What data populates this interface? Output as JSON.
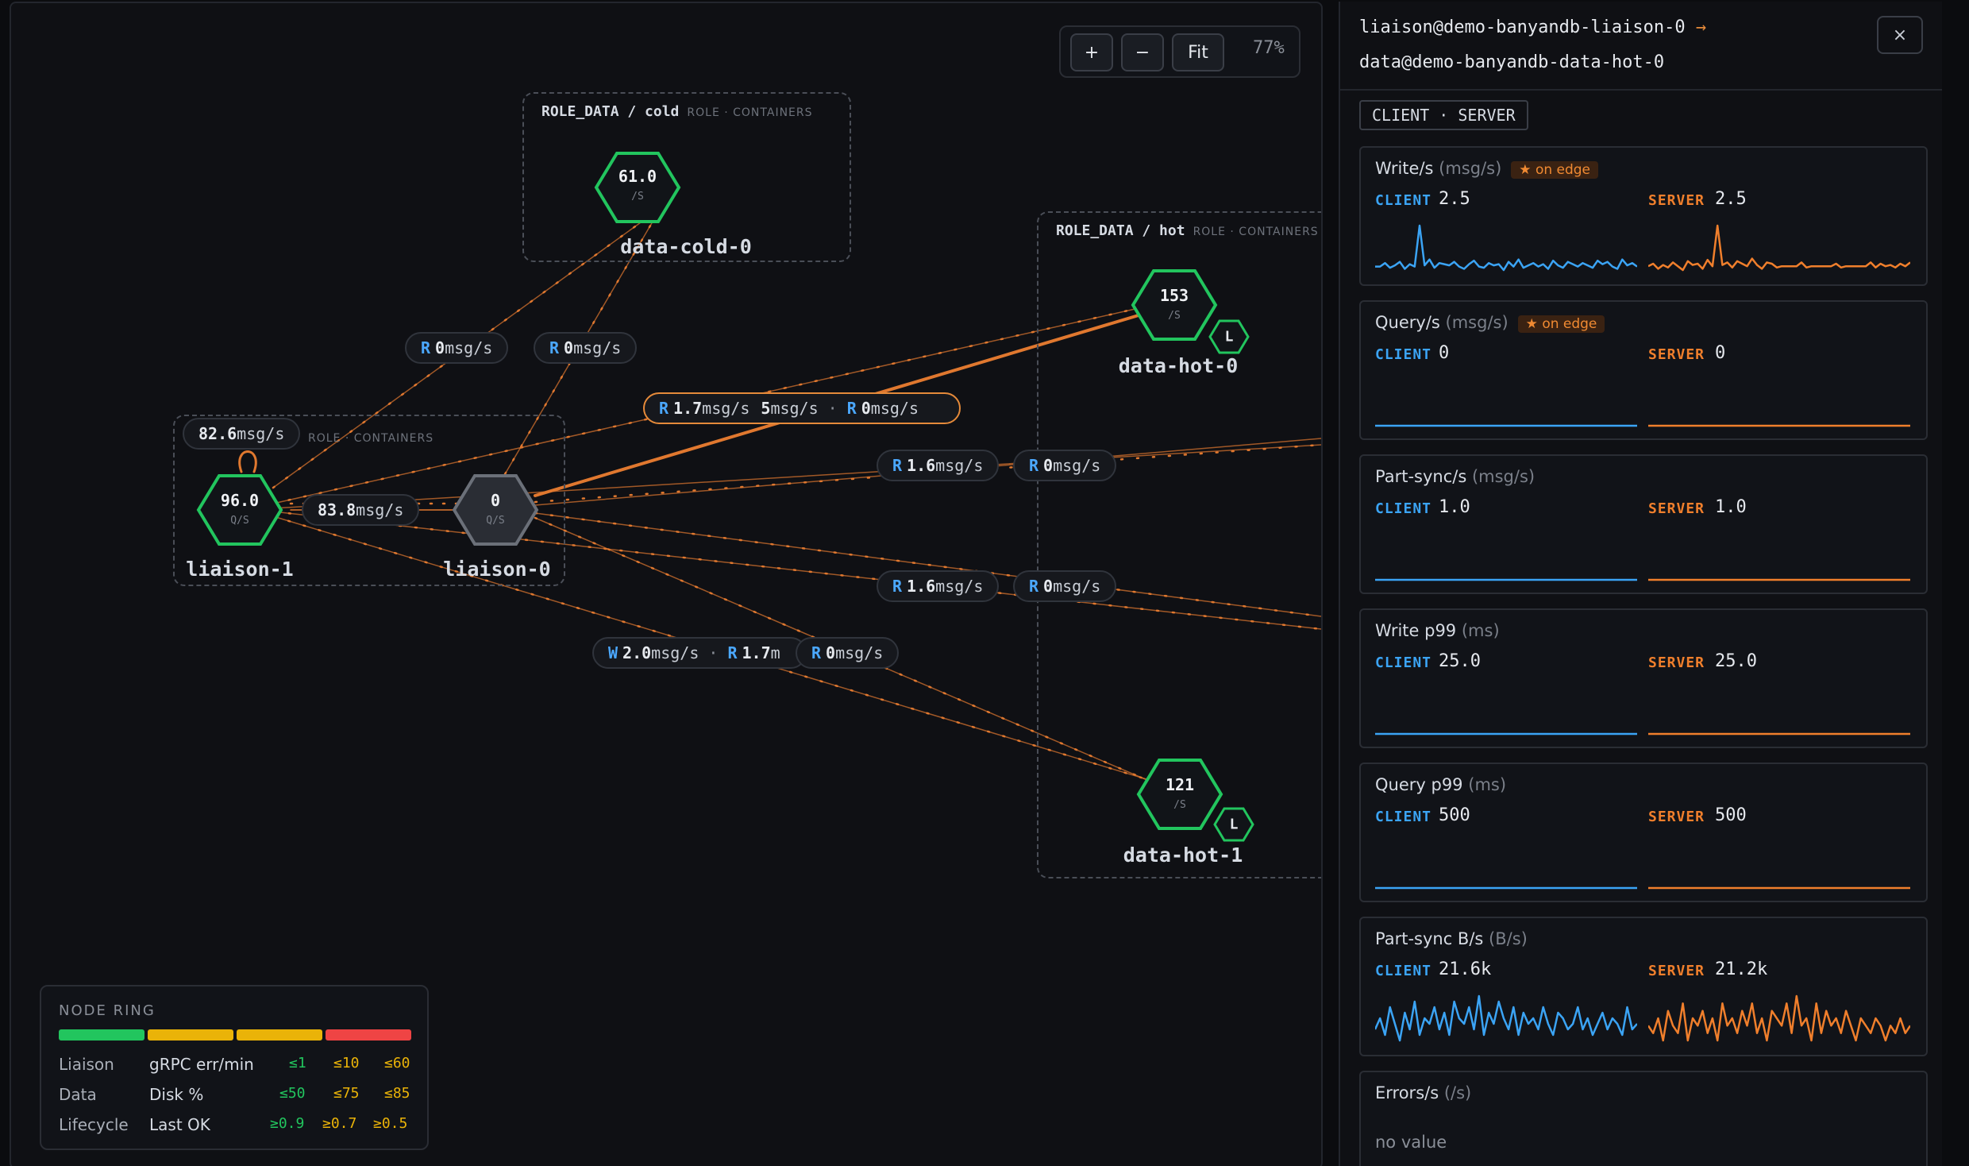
{
  "zoom": {
    "plus": "+",
    "minus": "−",
    "fit": "Fit",
    "level": "77%"
  },
  "groups": {
    "cold": {
      "name": "ROLE_DATA / cold",
      "sub": "ROLE · CONTAINERS"
    },
    "hot": {
      "name": "ROLE_DATA / hot",
      "sub": "ROLE · CONTAINERS"
    },
    "liaison": {
      "sub": "ROLE · CONTAINERS"
    }
  },
  "nodes": {
    "data_cold_0": {
      "name": "data-cold-0",
      "value": "61.0",
      "unit": "/S"
    },
    "data_hot_0": {
      "name": "data-hot-0",
      "value": "153",
      "unit": "/S",
      "badge": "L"
    },
    "data_hot_1": {
      "name": "data-hot-1",
      "value": "121",
      "unit": "/S",
      "badge": "L"
    },
    "liaison_1": {
      "name": "liaison-1",
      "value": "96.0",
      "unit": "Q/S"
    },
    "liaison_0": {
      "name": "liaison-0",
      "value": "0",
      "unit": "Q/S"
    }
  },
  "edge_labels": {
    "cold_a": {
      "kind": "R",
      "value": "0",
      "unit": "msg/s"
    },
    "cold_b": {
      "kind": "R",
      "value": "0",
      "unit": "msg/s"
    },
    "hot0_main": {
      "kind": "R",
      "value": "1.7",
      "unit": "msg/s",
      "extra_value": "5",
      "extra_unit": "msg/s",
      "kind2": "R",
      "value2": "0",
      "unit2": "msg/s"
    },
    "self_loop": {
      "value": "82.6",
      "unit": "msg/s"
    },
    "liaison_link": {
      "value": "83.8",
      "unit": "msg/s"
    },
    "right_a1": {
      "kind": "R",
      "value": "1.6",
      "unit": "msg/s"
    },
    "right_a2": {
      "kind": "R",
      "value": "0",
      "unit": "msg/s"
    },
    "right_b1": {
      "kind": "R",
      "value": "1.6",
      "unit": "msg/s"
    },
    "right_b2": {
      "kind": "R",
      "value": "0",
      "unit": "msg/s"
    },
    "hot1_a": {
      "kind": "W",
      "value": "2.0",
      "unit": "msg/s",
      "kind2": "R",
      "value2": "1.7",
      "unit2": "m"
    },
    "hot1_b": {
      "kind": "R",
      "value": "0",
      "unit": "msg/s"
    }
  },
  "legend": {
    "title": "NODE RING",
    "colors": [
      "#22c55e",
      "#eab308",
      "#eab308",
      "#ef4444"
    ],
    "rows": [
      {
        "role": "Liaison",
        "metric": "gRPC err/min",
        "t1": "≤1",
        "t2": "≤10",
        "t3": "≤60"
      },
      {
        "role": "Data",
        "metric": "Disk %",
        "t1": "≤50",
        "t2": "≤75",
        "t3": "≤85"
      },
      {
        "role": "Lifecycle",
        "metric": "Last OK",
        "t1": "≥0.9",
        "t2": "≥0.7",
        "t3": "≥0.5"
      }
    ]
  },
  "side": {
    "from": "liaison@demo-banyandb-liaison-0",
    "arrow": "→",
    "to": "data@demo-banyandb-data-hot-0",
    "close": "×",
    "mode": "CLIENT · SERVER",
    "client_label": "CLIENT",
    "server_label": "SERVER",
    "client_color": "#3ba4f5",
    "server_color": "#f07f2c",
    "metrics": [
      {
        "title": "Write/s",
        "unit": "(msg/s)",
        "on_edge": "★ on edge",
        "client": "2.5",
        "server": "2.5",
        "client_series": [
          2,
          2,
          2.3,
          1.9,
          2.1,
          2.4,
          1.8,
          2.2,
          2,
          5.5,
          2.1,
          2.6,
          1.9,
          2.3,
          2.2,
          2.1,
          2.4,
          2,
          1.8,
          2.2,
          2.5,
          2,
          1.9,
          2.3,
          2.1,
          2.2,
          1.7,
          2.4,
          2,
          2.6,
          1.9,
          2.1,
          2.3,
          2,
          2.2,
          1.8,
          2.5,
          2.1,
          1.9,
          2.4,
          2.2,
          2,
          2.3,
          2.1,
          1.9,
          2.5,
          2.2,
          2.4,
          2,
          1.8,
          2.6,
          2.1,
          2.3,
          2
        ],
        "server_series": [
          2,
          2.2,
          1.8,
          2.1,
          1.9,
          2.3,
          2,
          1.7,
          2.4,
          2.1,
          2.2,
          1.8,
          2.5,
          2,
          5.2,
          2.1,
          2.3,
          1.9,
          2.4,
          2.2,
          2,
          2.6,
          2.1,
          1.8,
          2.3,
          2.2,
          1.9,
          2,
          2,
          2,
          2,
          2.3,
          1.9,
          2,
          2,
          2,
          2,
          2,
          2.2,
          1.9,
          2,
          2,
          2,
          2,
          2,
          2.3,
          1.9,
          2.2,
          2,
          2.1,
          1.9,
          2.2,
          2,
          2.3
        ]
      },
      {
        "title": "Query/s",
        "unit": "(msg/s)",
        "on_edge": "★ on edge",
        "client": "0",
        "server": "0",
        "client_series": [],
        "server_series": []
      },
      {
        "title": "Part-sync/s",
        "unit": "(msg/s)",
        "on_edge": "",
        "client": "1.0",
        "server": "1.0",
        "client_series": [],
        "server_series": []
      },
      {
        "title": "Write p99",
        "unit": "(ms)",
        "on_edge": "",
        "client": "25.0",
        "server": "25.0",
        "client_series": [],
        "server_series": []
      },
      {
        "title": "Query p99",
        "unit": "(ms)",
        "on_edge": "",
        "client": "500",
        "server": "500",
        "client_series": [],
        "server_series": []
      },
      {
        "title": "Part-sync B/s",
        "unit": "(B/s)",
        "on_edge": "",
        "client": "21.6k",
        "server": "21.2k",
        "client_series": [
          20,
          22,
          19,
          24,
          21,
          18,
          23,
          20,
          25,
          19,
          22,
          21,
          24,
          20,
          23,
          19,
          25,
          22,
          21,
          24,
          20,
          26,
          19,
          23,
          21,
          25,
          22,
          20,
          24,
          19,
          23,
          21,
          22,
          20,
          24,
          21,
          19,
          23,
          22,
          20,
          21,
          24,
          20,
          22,
          19,
          21,
          23,
          20,
          22,
          21,
          19,
          24,
          20,
          21
        ],
        "server_series": [
          21,
          20,
          22,
          19,
          23,
          21,
          20,
          24,
          19,
          22,
          21,
          23,
          20,
          22,
          19,
          24,
          21,
          22,
          20,
          23,
          21,
          24,
          20,
          22,
          19,
          23,
          22,
          21,
          24,
          20,
          25,
          21,
          22,
          19,
          24,
          20,
          23,
          21,
          22,
          20,
          23,
          21,
          19,
          22,
          21,
          20,
          22,
          21,
          19,
          21,
          20,
          22,
          20,
          21
        ]
      },
      {
        "title": "Errors/s",
        "unit": "(/s)",
        "on_edge": "",
        "no_value": "no value"
      }
    ]
  }
}
